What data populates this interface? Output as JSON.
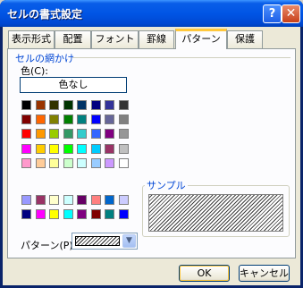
{
  "window": {
    "title": "セルの書式設定",
    "help_glyph": "?",
    "close_glyph": "✕"
  },
  "tabs": [
    {
      "label": "表示形式"
    },
    {
      "label": "配置"
    },
    {
      "label": "フォント"
    },
    {
      "label": "罫線"
    },
    {
      "label": "パターン",
      "active": true
    },
    {
      "label": "保護"
    }
  ],
  "shading": {
    "group_label": "セルの網かけ",
    "color_label": "色(C):",
    "no_color_label": "色なし",
    "palette_rows": [
      [
        "#000000",
        "#993300",
        "#333300",
        "#003300",
        "#003366",
        "#000080",
        "#333399",
        "#333333"
      ],
      [
        "#800000",
        "#FF6600",
        "#808000",
        "#008000",
        "#008080",
        "#0000FF",
        "#666699",
        "#808080"
      ],
      [
        "#FF0000",
        "#FF9900",
        "#99CC00",
        "#339966",
        "#33CCCC",
        "#3366FF",
        "#800080",
        "#969696"
      ],
      [
        "#FF00FF",
        "#FFCC00",
        "#FFFF00",
        "#00FF00",
        "#00FFFF",
        "#00CCFF",
        "#993366",
        "#C0C0C0"
      ],
      [
        "#FF99CC",
        "#FFCC99",
        "#FFFF99",
        "#CCFFCC",
        "#CCFFFF",
        "#99CCFF",
        "#CC99FF",
        "#FFFFFF"
      ]
    ],
    "chart_rows": [
      [
        "#9999FF",
        "#993366",
        "#FFFFCC",
        "#CCFFFF",
        "#660066",
        "#FF8080",
        "#0066CC",
        "#CCCCFF"
      ],
      [
        "#000080",
        "#FF00FF",
        "#FFFF00",
        "#00FFFF",
        "#800080",
        "#800000",
        "#008080",
        "#0000FF"
      ]
    ]
  },
  "sample": {
    "label": "サンプル"
  },
  "pattern": {
    "label": "パターン(P):",
    "dropdown_glyph": "▼"
  },
  "buttons": {
    "ok": "OK",
    "cancel": "キャンセル"
  }
}
